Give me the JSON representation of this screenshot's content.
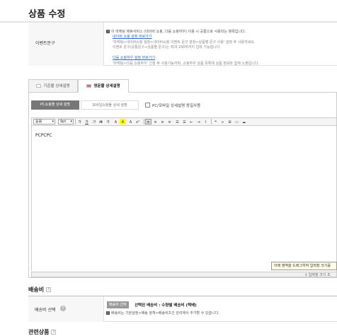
{
  "page": {
    "title": "상품 수정"
  },
  "event": {
    "label": "이벤트문구",
    "lines": [
      {
        "text": "이 마케팅 제휴서비스 (네이버 쇼핑, 다음 쇼핑하우) 이용 시 공통으로 사용되는 항목입니다.",
        "type": "info"
      },
      {
        "text": "네이버 쇼핑 설정 바로가기",
        "type": "link"
      },
      {
        "text": "'마케팅>네이버쇼핑 설정>네이버쇼핑 이벤트 문구 설정>상품별 문구 사용' 설정 후 사용하세요.",
        "type": "gray"
      },
      {
        "text": "이벤트 문구(공통문구+상품별 문구)는 최대 100자까지 입력 가능합니다.",
        "type": "gray"
      },
      {
        "text": "다음 쇼핑하우 설정 바로가기",
        "type": "link"
      },
      {
        "text": "'마케팅>다음 쇼핑하우' 신청 후 사용가능하며, 쇼핑하우 상품 목록에 상품 정보와 함께 노출됩니다.",
        "type": "gray"
      }
    ]
  },
  "tabs": [
    {
      "label": "기준몰 상세설명",
      "active": false,
      "flag": "kr"
    },
    {
      "label": "영문몰 상세설명",
      "active": true,
      "flag": "us"
    }
  ],
  "editor": {
    "subtabs": [
      "PC쇼핑몰 상세 설명",
      "모바일쇼핑몰 상세 설명"
    ],
    "checkbox_label": "PC/모바일 상세설명 동일사용",
    "font_select": "돋움",
    "size_select": "9pt",
    "toolbar_buttons": [
      "가",
      "가",
      "가",
      "가",
      "가",
      "A",
      "A",
      "A",
      "x²",
      "x₂",
      "≡",
      "≡",
      "≡",
      "≡",
      "☰",
      "☰",
      "⇤",
      "⇥",
      "I",
      "❝",
      "∞",
      "⊞",
      "▭",
      "☁"
    ],
    "content": "PCPCPC",
    "tooltip": "아래 영역을 드래그하여 입력창 크기를",
    "resize_label": "↕ 입력창 크기 조"
  },
  "shipping": {
    "section_title": "배송비",
    "label": "배송비 선택",
    "badge": "배송비 선택",
    "selected": "선택된 배송비 : 수량별 배송비 (택배)",
    "note": "배송비는 기본설정>배송 정책>배송비조건 관리에서 추가할 수 있습니다."
  },
  "related": {
    "section_title": "관련상품"
  }
}
